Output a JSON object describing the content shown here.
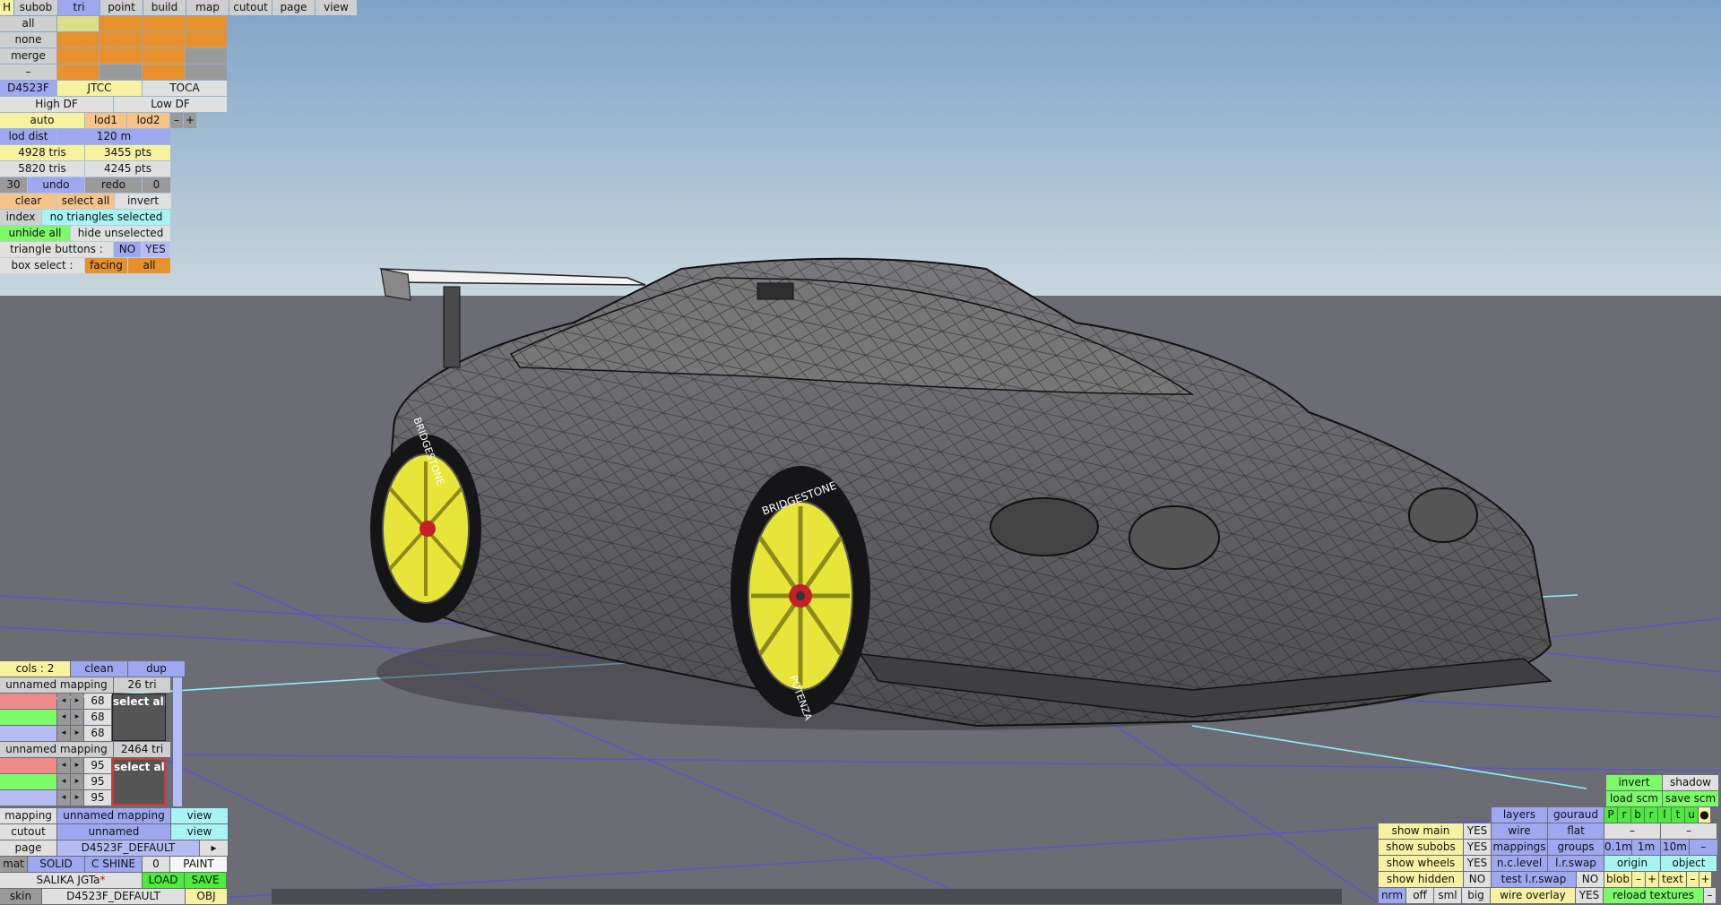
{
  "menu": [
    "subob",
    "tri",
    "point",
    "build",
    "map",
    "cutout",
    "page",
    "view"
  ],
  "menu_h": "H",
  "sel_rows": [
    "all",
    "none",
    "merge",
    "–"
  ],
  "presets": [
    "D4523F",
    "JTCC",
    "TOCA"
  ],
  "df": [
    "High DF",
    "Low DF"
  ],
  "lod": {
    "auto": "auto",
    "lod1": "lod1",
    "lod2": "lod2",
    "minus": "–",
    "plus": "+"
  },
  "lod_dist": {
    "label": "lod dist",
    "value": "120 m"
  },
  "stats": {
    "tris1": "4928 tris",
    "pts1": "3455 pts",
    "tris2": "5820 tris",
    "pts2": "4245 pts"
  },
  "undo": {
    "count": "30",
    "undo": "undo",
    "redo": "redo",
    "redo_count": "0"
  },
  "selection": {
    "clear": "clear",
    "select_all": "select all",
    "invert": "invert"
  },
  "index": {
    "label": "index",
    "status": "no triangles selected"
  },
  "hide": {
    "unhide_all": "unhide all",
    "hide_unselected": "hide unselected"
  },
  "tri_buttons": {
    "label": "triangle buttons :",
    "no": "NO",
    "yes": "YES"
  },
  "box_select": {
    "label": "box select :",
    "facing": "facing",
    "all": "all"
  },
  "cols": {
    "label": "cols : 2",
    "clean": "clean",
    "dup": "dup"
  },
  "mappings": [
    {
      "name": "unnamed mapping",
      "count": "26 tri",
      "values": [
        "68",
        "68",
        "68"
      ],
      "select_all": "select all"
    },
    {
      "name": "unnamed mapping",
      "count": "2464 tri",
      "values": [
        "95",
        "95",
        "95"
      ],
      "select_all": "select all"
    }
  ],
  "props": {
    "mapping": {
      "label": "mapping",
      "value": "unnamed mapping",
      "action": "view"
    },
    "cutout": {
      "label": "cutout",
      "value": "unnamed",
      "action": "view"
    },
    "page": {
      "label": "page",
      "value": "D4523F_DEFAULT",
      "action": "▸"
    },
    "mat": {
      "label": "mat",
      "solid": "SOLID",
      "shine": "C SHINE",
      "num": "0",
      "paint": "PAINT"
    },
    "car": {
      "name": "SALIKA JGTa",
      "star": "*",
      "load": "LOAD",
      "save": "SAVE"
    },
    "skin": {
      "label": "skin",
      "value": "D4523F_DEFAULT",
      "action": "OBJ"
    }
  },
  "right": {
    "invert": "invert",
    "shadow": "shadow",
    "load_scm": "load scm",
    "save_scm": "save scm",
    "letters": [
      "P",
      "r",
      "b",
      "r",
      "l",
      "t",
      "u",
      "●"
    ],
    "layers": "layers",
    "gouraud": "gouraud",
    "wire": "wire",
    "flat": "flat",
    "dash": "–",
    "mappings": "mappings",
    "groups": "groups",
    "scale": [
      "0.1m",
      "1m",
      "10m",
      "–"
    ],
    "nclevel": "n.c.level",
    "lrswap": "l.r.swap",
    "origin": "origin",
    "object": "object",
    "test_lrswap": "test l.r.swap",
    "no": "NO",
    "blob": "blob",
    "text": "text",
    "minus": "–",
    "plus": "+",
    "wire_overlay": "wire overlay",
    "yes": "YES",
    "reload_textures": "reload textures",
    "show": [
      {
        "label": "show main",
        "value": "YES"
      },
      {
        "label": "show subobs",
        "value": "YES"
      },
      {
        "label": "show wheels",
        "value": "YES"
      },
      {
        "label": "show hidden",
        "value": "NO"
      }
    ],
    "bottom": [
      "nrm",
      "off",
      "sml",
      "big"
    ]
  },
  "tire_text": "BRIDGESTONE",
  "tire_text2": "POTENZA",
  "colors": {
    "sky_top": "#7fa3c7",
    "sky_bottom": "#c6d6df",
    "ground": "#6b6c74",
    "grid": "#5a52d8",
    "axis": "#8ef0ff",
    "wheel": "#e7e53a",
    "body": "#5e5e60"
  }
}
